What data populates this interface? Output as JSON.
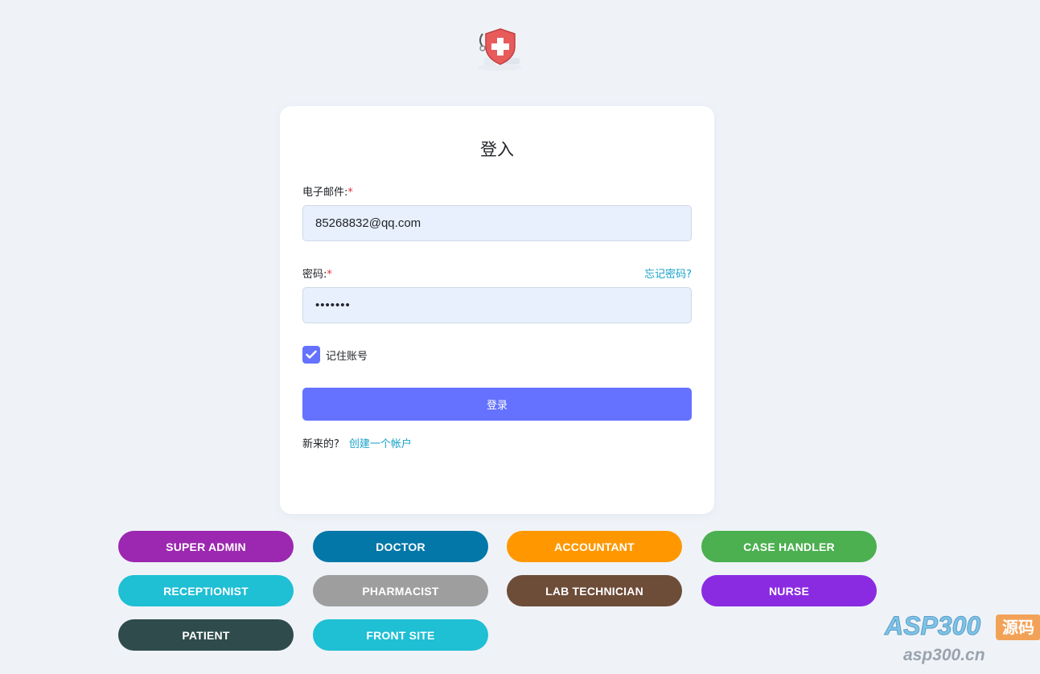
{
  "login": {
    "title": "登入",
    "email_label": "电子邮件:",
    "email_value": "85268832@qq.com",
    "required_mark": "*",
    "password_label": "密码:",
    "password_value": "1234567",
    "forgot_link": "忘记密码?",
    "remember_label": "记住账号",
    "remember_checked": true,
    "submit_label": "登录",
    "new_user_text": "新来的?",
    "create_account_link": "创建一个帐户"
  },
  "roles": [
    {
      "label": "SUPER ADMIN",
      "color": "#9c27b0"
    },
    {
      "label": "DOCTOR",
      "color": "#0277a8"
    },
    {
      "label": "ACCOUNTANT",
      "color": "#ff9800"
    },
    {
      "label": "CASE HANDLER",
      "color": "#4caf50"
    },
    {
      "label": "RECEPTIONIST",
      "color": "#1fbfd4"
    },
    {
      "label": "PHARMACIST",
      "color": "#9e9e9e"
    },
    {
      "label": "LAB TECHNICIAN",
      "color": "#6d4c38"
    },
    {
      "label": "NURSE",
      "color": "#8a2be2"
    },
    {
      "label": "PATIENT",
      "color": "#2f4b4b"
    },
    {
      "label": "FRONT SITE",
      "color": "#1fbfd4"
    }
  ],
  "watermark": {
    "brand": "ASP300",
    "tag": "源码",
    "url": "asp300.cn"
  },
  "theme": {
    "accent": "#6571ff",
    "link": "#17a2c8",
    "background": "#eff3f8"
  },
  "icons": {
    "logo": "medical-shield-icon",
    "checkbox": "check-icon"
  }
}
